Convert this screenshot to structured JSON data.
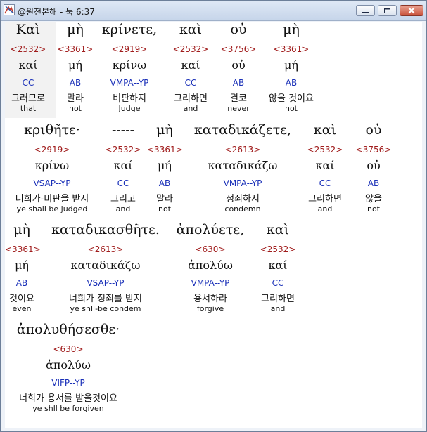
{
  "window": {
    "title": "@원전본해 - 눅 6:37",
    "icon": "app-logo-icon",
    "buttons": {
      "minimize": "minimize-icon",
      "maximize": "maximize-icon",
      "close": "close-icon"
    }
  },
  "lines": [
    {
      "words": [
        {
          "greek": "Καὶ",
          "code": "<2532>",
          "lemma": "καί",
          "parse": "CC",
          "korean": "그러므로",
          "english": "that"
        },
        {
          "greek": "μὴ",
          "code": "<3361>",
          "lemma": "μή",
          "parse": "AB",
          "korean": "말라",
          "english": "not"
        },
        {
          "greek": "κρίνετε,",
          "code": "<2919>",
          "lemma": "κρίνω",
          "parse": "VMPA--YP",
          "korean": "비판하지",
          "english": "Judge"
        },
        {
          "greek": "καὶ",
          "code": "<2532>",
          "lemma": "καί",
          "parse": "CC",
          "korean": "그리하면",
          "english": "and"
        },
        {
          "greek": "οὐ",
          "code": "<3756>",
          "lemma": "οὐ",
          "parse": "AB",
          "korean": "결코",
          "english": "never"
        },
        {
          "greek": "μὴ",
          "code": "<3361>",
          "lemma": "μή",
          "parse": "AB",
          "korean": "않을 것이요",
          "english": "not"
        }
      ]
    },
    {
      "words": [
        {
          "greek": "κριθῆτε·",
          "code": "<2919>",
          "lemma": "κρίνω",
          "parse": "VSAP--YP",
          "korean": "너희가-비판을 받지",
          "english": "ye shall be judged"
        },
        {
          "greek": "-----",
          "code": "<2532>",
          "lemma": "καί",
          "parse": "CC",
          "korean": "그리고",
          "english": "and"
        },
        {
          "greek": "μὴ",
          "code": "<3361>",
          "lemma": "μή",
          "parse": "AB",
          "korean": "말라",
          "english": "not"
        },
        {
          "greek": "καταδικάζετε,",
          "code": "<2613>",
          "lemma": "καταδικάζω",
          "parse": "VMPA--YP",
          "korean": "정죄하지",
          "english": "condemn"
        },
        {
          "greek": "καὶ",
          "code": "<2532>",
          "lemma": "καί",
          "parse": "CC",
          "korean": "그리하면",
          "english": "and"
        },
        {
          "greek": "οὐ",
          "code": "<3756>",
          "lemma": "οὐ",
          "parse": "AB",
          "korean": "않을",
          "english": "not"
        }
      ]
    },
    {
      "words": [
        {
          "greek": "μὴ",
          "code": "<3361>",
          "lemma": "μή",
          "parse": "AB",
          "korean": "것이요",
          "english": "even"
        },
        {
          "greek": "καταδικασθῆτε.",
          "code": "<2613>",
          "lemma": "καταδικάζω",
          "parse": "VSAP--YP",
          "korean": "너희가 정죄를 받지",
          "english": "ye shll-be condem"
        },
        {
          "greek": "ἀπολύετε,",
          "code": "<630>",
          "lemma": "ἀπολύω",
          "parse": "VMPA--YP",
          "korean": "용서하라",
          "english": "forgive"
        },
        {
          "greek": "καὶ",
          "code": "<2532>",
          "lemma": "καί",
          "parse": "CC",
          "korean": "그리하면",
          "english": "and"
        }
      ]
    },
    {
      "words": [
        {
          "greek": "ἀπολυθήσεσθε·",
          "code": "<630>",
          "lemma": "ἀπολύω",
          "parse": "VIFP--YP",
          "korean": "너희가 용서를 받을것이요",
          "english": "ye shll be forgiven"
        }
      ]
    }
  ]
}
